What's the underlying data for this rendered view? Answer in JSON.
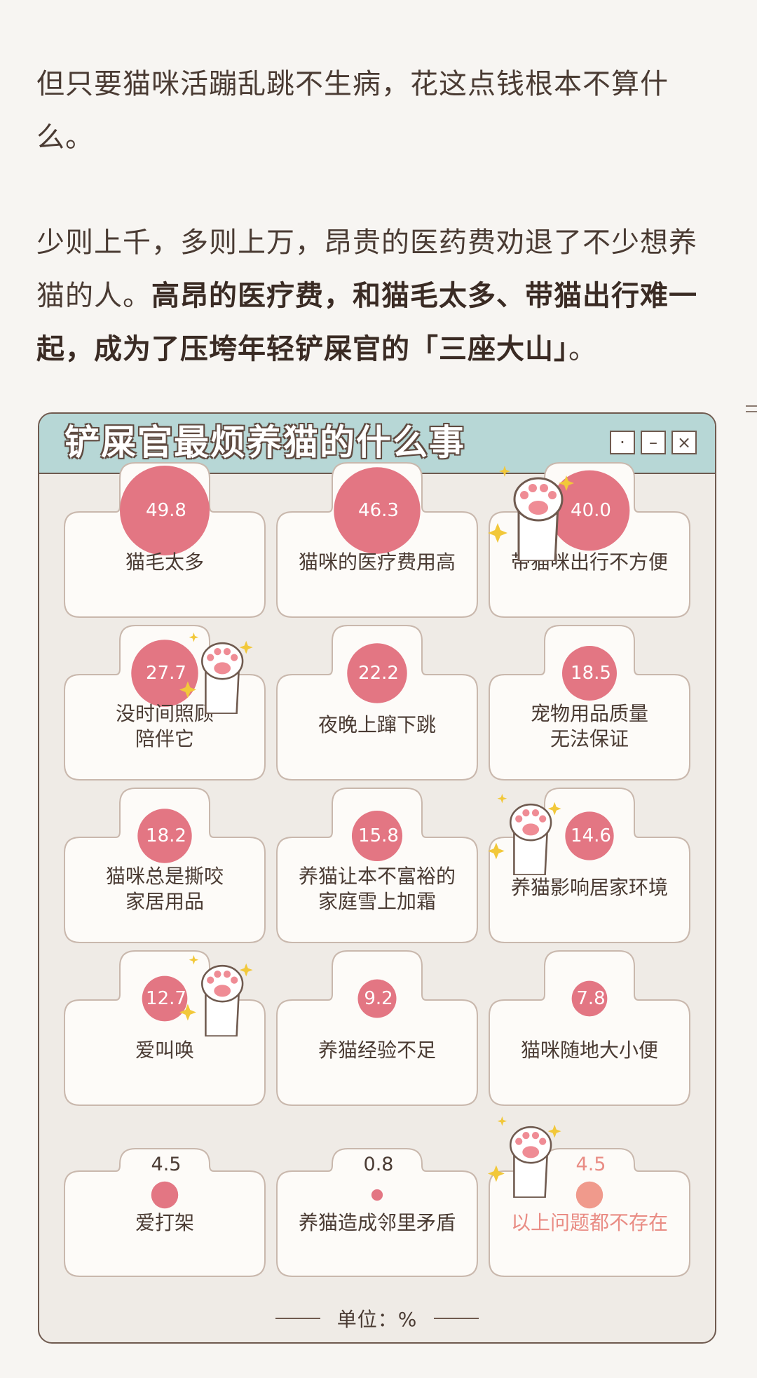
{
  "article": {
    "para1": "但只要猫咪活蹦乱跳不生病，花这点钱根本不算什么。",
    "para2_plain": "少则上千，多则上万，昂贵的医药费劝退了不少想养猫的人。",
    "para2_bold": "高昂的医疗费，和猫毛太多、带猫出行难一起，成为了压垮年轻铲屎官的「三座大山」",
    "para2_end": "。"
  },
  "window": {
    "title": "铲屎官最烦养猫的什么事",
    "buttons": [
      "·",
      "–",
      "×"
    ]
  },
  "chart_data": {
    "type": "bubble",
    "title": "铲屎官最烦养猫的什么事",
    "unit_label": "单位：%",
    "items": [
      {
        "label": "猫毛太多",
        "value": 49.8
      },
      {
        "label": "猫咪的医疗费用高",
        "value": 46.3
      },
      {
        "label": "带猫咪出行不方便",
        "value": 40.0
      },
      {
        "label": "没时间照顾\n陪伴它",
        "value": 27.7
      },
      {
        "label": "夜晚上蹿下跳",
        "value": 22.2
      },
      {
        "label": "宠物用品质量\n无法保证",
        "value": 18.5
      },
      {
        "label": "猫咪总是撕咬\n家居用品",
        "value": 18.2
      },
      {
        "label": "养猫让本不富裕的\n家庭雪上加霜",
        "value": 15.8
      },
      {
        "label": "养猫影响居家环境",
        "value": 14.6
      },
      {
        "label": "爱叫唤",
        "value": 12.7
      },
      {
        "label": "养猫经验不足",
        "value": 9.2
      },
      {
        "label": "猫咪随地大小便",
        "value": 7.8
      },
      {
        "label": "爱打架",
        "value": 4.5
      },
      {
        "label": "养猫造成邻里矛盾",
        "value": 0.8
      },
      {
        "label": "以上问题都不存在",
        "value": 4.5,
        "highlight": true
      }
    ],
    "value_strings": [
      "49.8",
      "46.3",
      "40.0",
      "27.7",
      "22.2",
      "18.5",
      "18.2",
      "15.8",
      "14.6",
      "12.7",
      "9.2",
      "7.8",
      "4.5",
      "0.8",
      "4.5"
    ]
  },
  "colors": {
    "accent": "#e37683",
    "highlight": "#f09a8c",
    "titlebar": "#b7d7d6",
    "border": "#6f5a4f",
    "card_bg": "#fdfbf8"
  }
}
